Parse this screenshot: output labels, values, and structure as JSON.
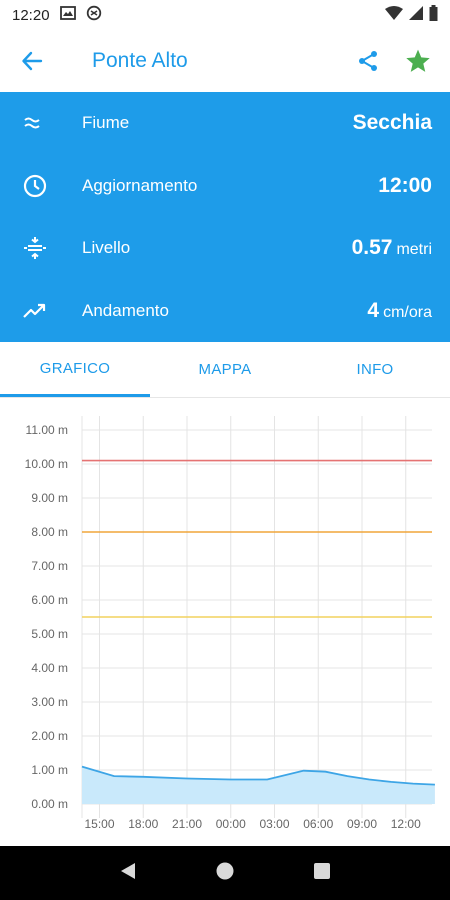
{
  "status": {
    "time": "12:20"
  },
  "header": {
    "title": "Ponte Alto"
  },
  "info": {
    "river_label": "Fiume",
    "river_value": "Secchia",
    "update_label": "Aggiornamento",
    "update_value": "12:00",
    "level_label": "Livello",
    "level_value": "0.57",
    "level_unit": "metri",
    "trend_label": "Andamento",
    "trend_value": "4",
    "trend_unit": "cm/ora"
  },
  "tabs": [
    {
      "label": "GRAFICO"
    },
    {
      "label": "MAPPA"
    },
    {
      "label": "INFO"
    }
  ],
  "colors": {
    "accent": "#1E9CE9",
    "star": "#4CAF50"
  },
  "chart_data": {
    "type": "area",
    "y_tick_labels": [
      "0.00 m",
      "1.00 m",
      "2.00 m",
      "3.00 m",
      "4.00 m",
      "5.00 m",
      "6.00 m",
      "7.00 m",
      "8.00 m",
      "9.00 m",
      "10.00 m",
      "11.00 m"
    ],
    "x_tick_labels": [
      "15:00",
      "18:00",
      "21:00",
      "00:00",
      "03:00",
      "06:00",
      "09:00",
      "12:00"
    ],
    "ylim": [
      0,
      11
    ],
    "x_hours": [
      13.8,
      16,
      18,
      21,
      24,
      26.5,
      29,
      30.5,
      32,
      33.5,
      35,
      36.5,
      38
    ],
    "values": [
      1.1,
      0.82,
      0.8,
      0.75,
      0.72,
      0.72,
      0.98,
      0.95,
      0.82,
      0.72,
      0.65,
      0.6,
      0.57
    ],
    "xlim": [
      13.8,
      37.8
    ],
    "thresholds": [
      {
        "value": 10.1,
        "color": "#e57373"
      },
      {
        "value": 8.0,
        "color": "#f0a53a"
      },
      {
        "value": 5.5,
        "color": "#f2d25e"
      }
    ],
    "grid": true
  }
}
